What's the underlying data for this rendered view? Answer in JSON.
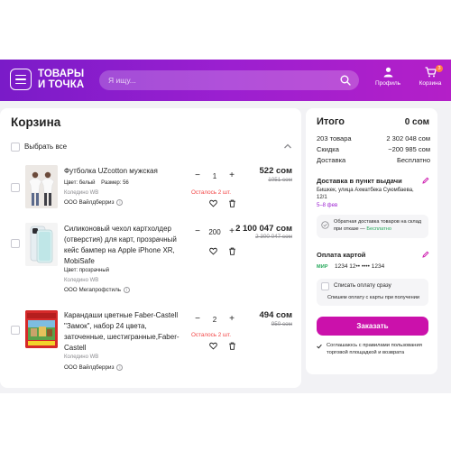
{
  "header": {
    "logo_line1": "ТОВАРЫ",
    "logo_line2": "И ТОЧКА",
    "search_placeholder": "Я ищу...",
    "profile_label": "Профиль",
    "cart_label": "Корзина",
    "cart_count": "3"
  },
  "cart": {
    "title": "Корзина",
    "select_all": "Выбрать все",
    "items": [
      {
        "name": "Футболка UZcotton мужская",
        "attr1_label": "Цвет: белый",
        "attr2_label": "Размер: 56",
        "store": "Коледино WB",
        "seller": "ООО Вайлдберриз",
        "qty": "1",
        "remaining": "Осталось 2 шт.",
        "price": "522 сом",
        "old_price": "1051 сом"
      },
      {
        "name": "Силиконовый чехол картхолдер (отверстия) для карт, прозрачный кейс бампер на Apple iPhone XR, MobiSafe",
        "attr1_label": "Цвет: прозрачный",
        "store": "Коледино WB",
        "seller": "ООО Мегапрофстиль",
        "qty": "200",
        "price": "2 100 047 сом",
        "old_price": "2 300 047 сом"
      },
      {
        "name": "Карандаши цветные Faber-Castell \"Замок\", набор 24 цвета, заточенные, шестигранные,Faber-Castell",
        "store": "Коледино WB",
        "seller": "ООО Вайлдберриз",
        "qty": "2",
        "remaining": "Осталось 2 шт.",
        "price": "494 сом",
        "old_price": "950 сом"
      }
    ]
  },
  "summary": {
    "title": "Итого",
    "total": "0 сом",
    "rows": [
      {
        "label": "203 товара",
        "value": "2 302 048 сом"
      },
      {
        "label": "Скидка",
        "value": "−200 985 сом"
      },
      {
        "label": "Доставка",
        "value": "Бесплатно"
      }
    ],
    "delivery_title": "Доставка в пункт выдачи",
    "delivery_address": "Бишкек, улица Ахматбека Суюмбаева, 12/1",
    "delivery_date": "5–8 фев",
    "return_text": "Обратная доставка товаров на склад при отказе —",
    "return_free": "Бесплатно",
    "payment_title": "Оплата картой",
    "card_brand": "МИР",
    "card_number": "1234 12•• •••• 1234",
    "pay_now_label": "Списать оплату сразу",
    "pay_note": "Спишем оплату с карты при получении",
    "order_button": "Заказать",
    "agree_text": "Соглашаюсь с правилами пользования торговой площадкой и возврата"
  },
  "colors": {
    "accent": "#cb11ab",
    "header_start": "#7a1bc8",
    "header_end": "#b41fc8",
    "warning": "#f24545",
    "success": "#25a85a"
  }
}
